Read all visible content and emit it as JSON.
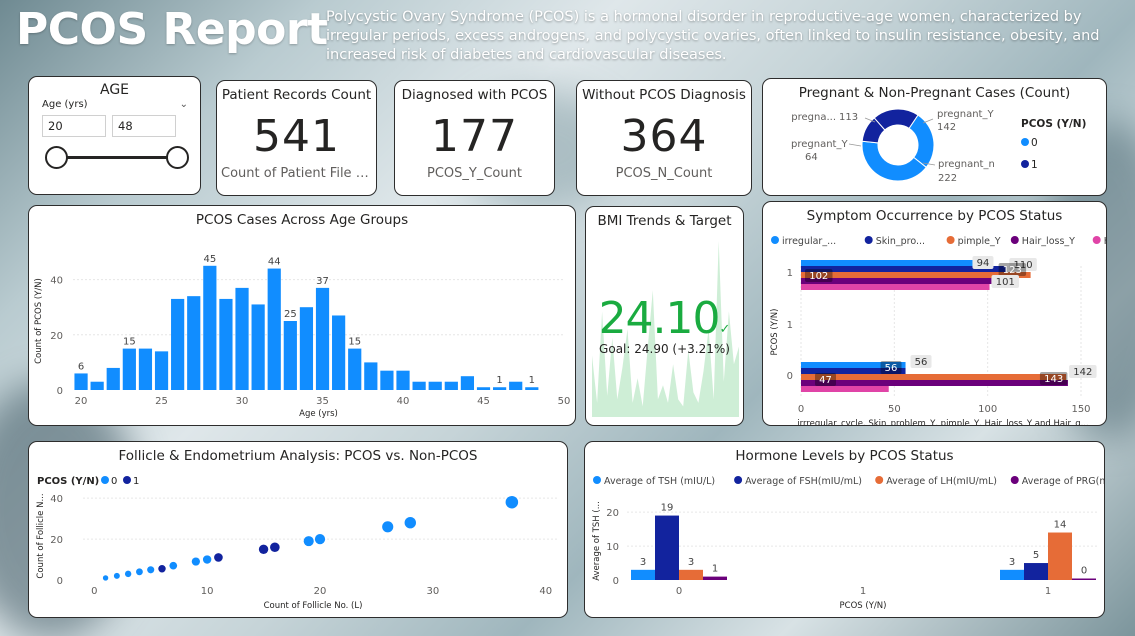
{
  "header": {
    "title": "PCOS Report",
    "description": "Polycystic Ovary Syndrome (PCOS) is a hormonal disorder in reproductive-age women, characterized by irregular periods, excess androgens, and polycystic ovaries, often linked to insulin resistance, obesity, and increased risk of diabetes and cardiovascular diseases."
  },
  "age_slicer": {
    "title": "AGE",
    "field": "Age (yrs)",
    "min_value": "20",
    "max_value": "48"
  },
  "kpis": {
    "records": {
      "title": "Patient Records Count",
      "value": "541",
      "label": "Count of Patient File N..."
    },
    "diagnosed": {
      "title": "Diagnosed with PCOS",
      "value": "177",
      "label": "PCOS_Y_Count"
    },
    "without": {
      "title": "Without PCOS Diagnosis",
      "value": "364",
      "label": "PCOS_N_Count"
    }
  },
  "bmi": {
    "title": "BMI Trends & Target",
    "value": "24.10",
    "check": "✓",
    "goal": "Goal: 24.90 (+3.21%)"
  },
  "colors": {
    "blue": "#118dff",
    "navy": "#12239e",
    "orange": "#e66c37",
    "purple": "#6b007b",
    "pink": "#e044a7",
    "green": "#1aab40",
    "light_green": "#c9ecd1"
  },
  "chart_data": [
    {
      "id": "pregnancy",
      "type": "pie",
      "title": "Pregnant & Non-Pregnant Cases (Count)",
      "legend_title": "PCOS (Y/N)",
      "legend": [
        {
          "label": "0",
          "color": "#118dff"
        },
        {
          "label": "1",
          "color": "#12239e"
        }
      ],
      "slices": [
        {
          "label": "pregna... 113",
          "value": 113,
          "color": "#12239e"
        },
        {
          "label": "pregnant_Y 142",
          "value": 142,
          "color": "#118dff"
        },
        {
          "label": "pregnant_n 222",
          "value": 222,
          "color": "#118dff"
        },
        {
          "label": "pregnant_Y 64",
          "value": 64,
          "color": "#12239e"
        }
      ],
      "labels": {
        "a1": "pregna...",
        "a2": "113",
        "b1": "pregnant_Y",
        "b2": "142",
        "c1": "pregnant_n",
        "c2": "222",
        "d1": "pregnant_Y",
        "d2": "64"
      }
    },
    {
      "id": "age_groups",
      "type": "bar",
      "title": "PCOS Cases Across Age Groups",
      "xlabel": "Age (yrs)",
      "ylabel": "Count of PCOS (Y/N)",
      "x": [
        20,
        21,
        22,
        23,
        24,
        25,
        26,
        27,
        28,
        29,
        30,
        31,
        32,
        33,
        34,
        35,
        36,
        37,
        38,
        39,
        40,
        41,
        42,
        43,
        44,
        45,
        46,
        47,
        48
      ],
      "values": [
        6,
        3,
        8,
        15,
        15,
        14,
        33,
        34,
        45,
        33,
        37,
        31,
        44,
        25,
        30,
        37,
        27,
        15,
        10,
        7,
        7,
        3,
        3,
        3,
        5,
        1,
        1,
        3,
        1
      ],
      "data_labels": {
        "20": "6",
        "23": "15",
        "28": "45",
        "32": "44",
        "33": "25",
        "35": "37",
        "37": "15",
        "46": "1",
        "48": "1"
      },
      "xticks": [
        20,
        25,
        30,
        35,
        40,
        45,
        50
      ],
      "yticks": [
        0,
        20,
        40
      ],
      "xlim": [
        19.5,
        50
      ],
      "ylim": [
        0,
        50
      ]
    },
    {
      "id": "bmi_trend",
      "type": "area",
      "values": [
        35,
        8,
        60,
        12,
        45,
        10,
        28,
        50,
        8,
        22,
        6,
        40,
        72,
        10,
        18,
        8,
        30,
        10,
        6,
        38,
        14,
        8,
        26,
        50,
        10,
        100,
        20,
        60,
        30,
        40
      ]
    },
    {
      "id": "symptoms",
      "type": "bar",
      "orientation": "horizontal",
      "title": "Symptom Occurrence by PCOS Status",
      "ylabel": "PCOS (Y/N)",
      "xlabel": "irrregular_cycle, Skin_problem_Y, pimple_Y, Hair_loss_Y and Hair_g...",
      "categories": [
        "1",
        "0"
      ],
      "series": [
        {
          "name": "irregular_...",
          "color": "#118dff",
          "values": [
            94,
            56
          ]
        },
        {
          "name": "Skin_pro...",
          "color": "#12239e",
          "values": [
            110,
            56
          ]
        },
        {
          "name": "pimple_Y",
          "color": "#e66c37",
          "values": [
            123,
            142
          ]
        },
        {
          "name": "Hair_loss_Y",
          "color": "#6b007b",
          "values": [
            102,
            143
          ]
        },
        {
          "name": "Hair_gro...",
          "color": "#e044a7",
          "values": [
            101,
            47
          ]
        }
      ],
      "data_labels": {
        "r1_s0": "94",
        "r1_s1": "110",
        "r1_s2": "123",
        "r1_s3": "102",
        "r1_s4": "101",
        "r0_s1": "56",
        "r0_s1b": "56",
        "r0_s2": "142",
        "r0_s3": "143",
        "r0_s4": "47"
      },
      "y_axis_labels": [
        "1",
        "1",
        "0"
      ],
      "xticks": [
        0,
        50,
        100,
        150
      ],
      "xlim": [
        0,
        150
      ]
    },
    {
      "id": "follicle",
      "type": "scatter",
      "title": "Follicle & Endometrium Analysis: PCOS vs. Non-PCOS",
      "legend_title": "PCOS (Y/N)",
      "legend": [
        {
          "label": "0",
          "color": "#118dff"
        },
        {
          "label": "1",
          "color": "#12239e"
        }
      ],
      "xlabel": "Count of Follicle No. (L)",
      "ylabel": "Count of Follicle N...",
      "xticks": [
        0,
        10,
        20,
        30,
        40
      ],
      "yticks": [
        0,
        20,
        40
      ],
      "xlim": [
        -1,
        41
      ],
      "ylim": [
        0,
        43
      ],
      "points": [
        {
          "x": 1,
          "y": 1,
          "g": 0
        },
        {
          "x": 2,
          "y": 2,
          "g": 0
        },
        {
          "x": 3,
          "y": 3,
          "g": 0
        },
        {
          "x": 4,
          "y": 4,
          "g": 0
        },
        {
          "x": 5,
          "y": 5,
          "g": 0
        },
        {
          "x": 6,
          "y": 5.5,
          "g": 1
        },
        {
          "x": 7,
          "y": 7,
          "g": 0
        },
        {
          "x": 9,
          "y": 9,
          "g": 0
        },
        {
          "x": 10,
          "y": 10,
          "g": 0
        },
        {
          "x": 11,
          "y": 11,
          "g": 1
        },
        {
          "x": 15,
          "y": 15,
          "g": 1
        },
        {
          "x": 16,
          "y": 16,
          "g": 1
        },
        {
          "x": 19,
          "y": 19,
          "g": 0
        },
        {
          "x": 20,
          "y": 20,
          "g": 0
        },
        {
          "x": 26,
          "y": 26,
          "g": 0
        },
        {
          "x": 28,
          "y": 28,
          "g": 0
        },
        {
          "x": 37,
          "y": 38,
          "g": 0
        }
      ]
    },
    {
      "id": "hormones",
      "type": "bar",
      "title": "Hormone Levels by PCOS Status",
      "xlabel": "PCOS (Y/N)",
      "ylabel": "Average of TSH (...",
      "categories": [
        "0",
        "1"
      ],
      "series": [
        {
          "name": "Average of TSH (mIU/L)",
          "color": "#118dff",
          "values": [
            3,
            3
          ]
        },
        {
          "name": "Average of FSH(mIU/mL)",
          "color": "#12239e",
          "values": [
            19,
            5
          ]
        },
        {
          "name": "Average of LH(mIU/mL)",
          "color": "#e66c37",
          "values": [
            3,
            14
          ]
        },
        {
          "name": "Average of PRG(ng/mL)",
          "color": "#6b007b",
          "values": [
            1,
            0
          ]
        }
      ],
      "data_labels": [
        [
          "3",
          "19",
          "3",
          "1"
        ],
        [
          "3",
          "5",
          "14",
          "0"
        ]
      ],
      "xticks": [
        "0",
        "1",
        "1"
      ],
      "yticks": [
        0,
        10,
        20
      ],
      "ylim": [
        0,
        23
      ]
    }
  ]
}
